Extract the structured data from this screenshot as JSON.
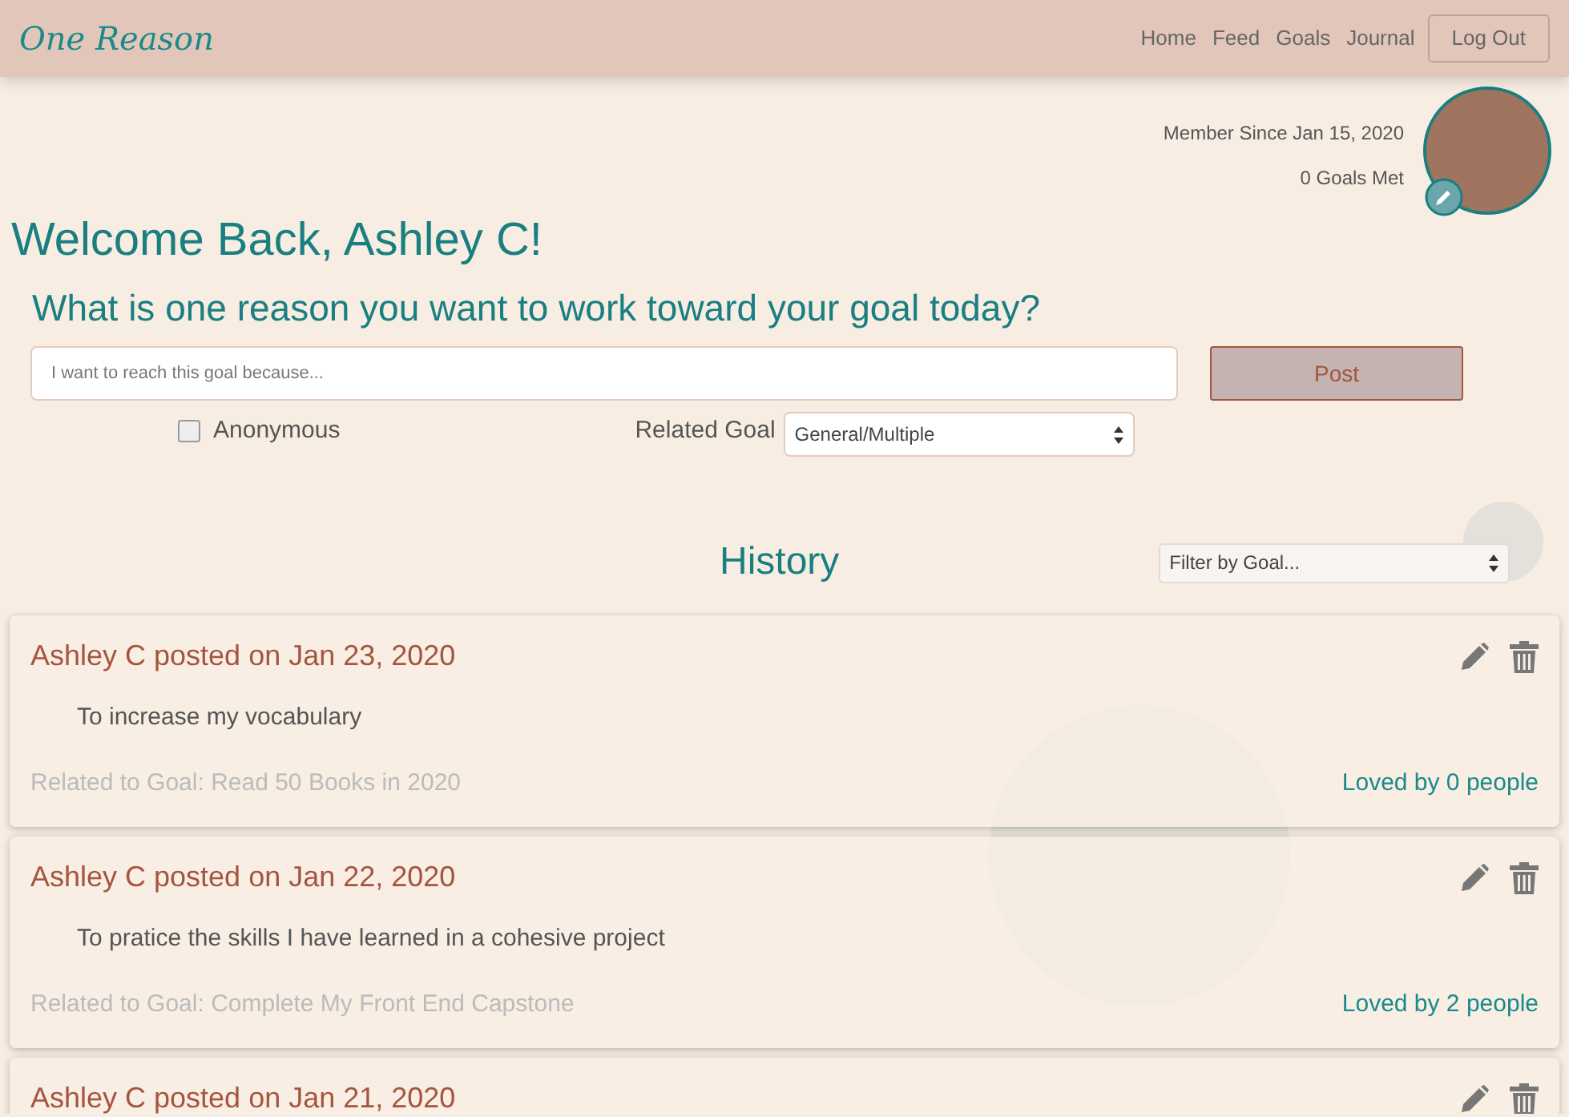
{
  "brand": "One Reason",
  "nav": [
    {
      "label": "Home"
    },
    {
      "label": "Feed"
    },
    {
      "label": "Goals"
    },
    {
      "label": "Journal"
    }
  ],
  "logout": "Log Out",
  "profile": {
    "member_since": "Member Since Jan 15, 2020",
    "goals_met": "0 Goals Met"
  },
  "welcome": "Welcome Back, Ashley C!",
  "prompt": "What is one reason you want to work toward your goal today?",
  "reason_field": {
    "placeholder": "I want to reach this goal because..."
  },
  "post_button": "Post",
  "anonymous": {
    "label": "Anonymous",
    "checked": false
  },
  "related_goal": {
    "label": "Related Goal",
    "value": "General/Multiple"
  },
  "history": {
    "title": "History",
    "filter": {
      "value": "Filter by Goal..."
    }
  },
  "posts": [
    {
      "header": "Ashley C posted on Jan 23, 2020",
      "body": "To increase my vocabulary",
      "goal": "Related to Goal: Read 50 Books in 2020",
      "loves": "Loved by 0 people"
    },
    {
      "header": "Ashley C posted on Jan 22, 2020",
      "body": "To pratice the skills I have learned in a cohesive project",
      "goal": "Related to Goal: Complete My Front End Capstone",
      "loves": "Loved by 2 people"
    },
    {
      "header": "Ashley C posted on Jan 21, 2020"
    }
  ]
}
